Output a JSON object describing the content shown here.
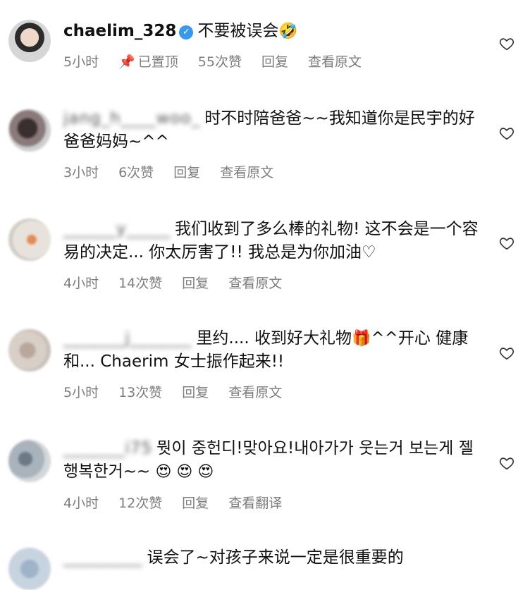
{
  "comments": [
    {
      "username": "chaelim_328",
      "verified": true,
      "text": "不要被误会",
      "emoji": "🤣",
      "meta": {
        "time": "5小时",
        "pinned": "已置顶",
        "likes": "55次赞",
        "reply": "回复",
        "view": "查看原文"
      }
    },
    {
      "username_blurred": "jang_h____woo_",
      "text": "时不时陪爸爸~~我知道你是民宇的好爸爸妈妈~^^",
      "meta": {
        "time": "3小时",
        "likes": "6次赞",
        "reply": "回复",
        "view": "查看原文"
      }
    },
    {
      "username_blurred": "______y_____",
      "text": "我们收到了多么棒的礼物! 这不会是一个容易的决定... 你太厉害了!! 我总是为你加油♡",
      "meta": {
        "time": "4小时",
        "likes": "14次赞",
        "reply": "回复",
        "view": "查看原文"
      }
    },
    {
      "username_blurred": "_______j_______",
      "text_before": "里约.... 收到好大礼物",
      "emoji": "🎁",
      "text_after": "^^开心 健康和... Chaerim 女士振作起来!!",
      "meta": {
        "time": "5小时",
        "likes": "13次赞",
        "reply": "回复",
        "view": "查看原文"
      }
    },
    {
      "username_blurred": "_______i75",
      "text": "뭣이 중헌디!맞아요!내아가가 웃는거 보는게 젤 행복한거~~",
      "emoji": "😍 😍 😍",
      "meta": {
        "time": "4小时",
        "likes": "12次赞",
        "reply": "回复",
        "view": "查看翻译"
      }
    },
    {
      "username_blurred": "_________",
      "text": "误会了~对孩子来说一定是很重要的"
    }
  ]
}
